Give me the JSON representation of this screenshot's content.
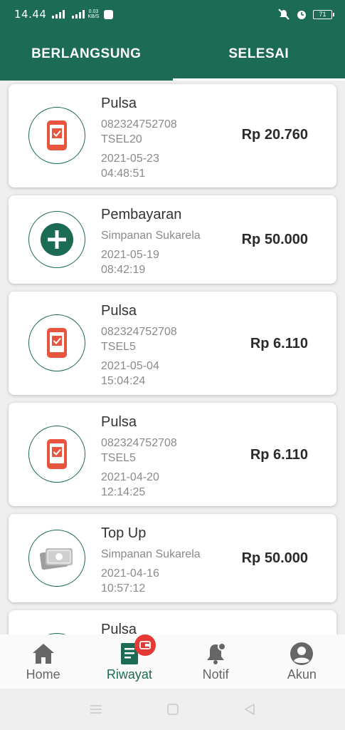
{
  "status_bar": {
    "time": "14.44",
    "network_speed_value": "0.03",
    "network_speed_unit": "KB/S",
    "battery": "71"
  },
  "tabs": [
    {
      "label": "BERLANGSUNG",
      "active": false
    },
    {
      "label": "SELESAI",
      "active": true
    }
  ],
  "transactions": [
    {
      "icon": "phone-check-icon",
      "title": "Pulsa",
      "line1": "082324752708",
      "line2": "TSEL20",
      "date": "2021-05-23",
      "time": "04:48:51",
      "amount": "Rp 20.760"
    },
    {
      "icon": "plus-circle-icon",
      "title": "Pembayaran",
      "line1": "Simpanan Sukarela",
      "date": "2021-05-19",
      "time": "08:42:19",
      "amount": "Rp 50.000"
    },
    {
      "icon": "phone-check-icon",
      "title": "Pulsa",
      "line1": "082324752708",
      "line2": "TSEL5",
      "date": "2021-05-04",
      "time": "15:04:24",
      "amount": "Rp 6.110"
    },
    {
      "icon": "phone-check-icon",
      "title": "Pulsa",
      "line1": "082324752708",
      "line2": "TSEL5",
      "date": "2021-04-20",
      "time": "12:14:25",
      "amount": "Rp 6.110"
    },
    {
      "icon": "money-icon",
      "title": "Top Up",
      "line1": "Simpanan Sukarela",
      "date": "2021-04-16",
      "time": "10:57:12",
      "amount": "Rp 50.000"
    },
    {
      "icon": "phone-check-icon",
      "title": "Pulsa"
    }
  ],
  "bottom_nav": [
    {
      "label": "Home",
      "icon": "home-icon",
      "active": false
    },
    {
      "label": "Riwayat",
      "icon": "history-icon",
      "active": true
    },
    {
      "label": "Notif",
      "icon": "bell-icon",
      "active": false
    },
    {
      "label": "Akun",
      "icon": "account-icon",
      "active": false
    }
  ],
  "colors": {
    "primary": "#1c6b54",
    "accent_red": "#e8553e",
    "badge_red": "#e53935"
  }
}
